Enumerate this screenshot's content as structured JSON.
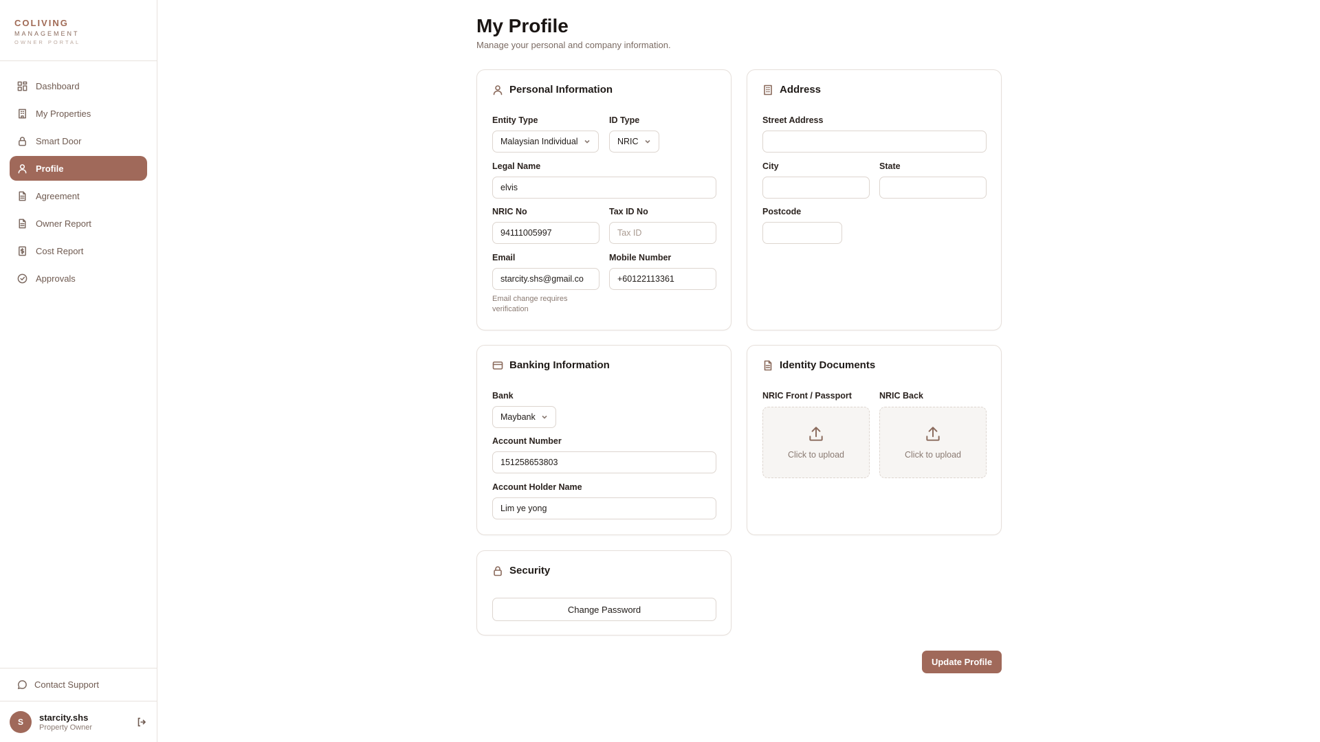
{
  "brand": {
    "title": "COLIVING",
    "subtitle": "MANAGEMENT",
    "portal": "OWNER PORTAL"
  },
  "colors": {
    "accent": "#a0695a",
    "border": "#e6dfda"
  },
  "sidebar": {
    "items": [
      {
        "label": "Dashboard",
        "icon": "grid-icon"
      },
      {
        "label": "My Properties",
        "icon": "building-icon"
      },
      {
        "label": "Smart Door",
        "icon": "lock-icon"
      },
      {
        "label": "Profile",
        "icon": "user-icon",
        "active": true
      },
      {
        "label": "Agreement",
        "icon": "document-icon"
      },
      {
        "label": "Owner Report",
        "icon": "document-icon"
      },
      {
        "label": "Cost Report",
        "icon": "dollar-document-icon"
      },
      {
        "label": "Approvals",
        "icon": "check-circle-icon"
      }
    ],
    "support": "Contact Support",
    "user": {
      "initial": "S",
      "name": "starcity.shs",
      "role": "Property Owner"
    }
  },
  "page": {
    "title": "My Profile",
    "subtitle": "Manage your personal and company information."
  },
  "personal": {
    "title": "Personal Information",
    "entity_type_label": "Entity Type",
    "entity_type_value": "Malaysian Individual",
    "id_type_label": "ID Type",
    "id_type_value": "NRIC",
    "legal_name_label": "Legal Name",
    "legal_name_value": "elvis",
    "nric_label": "NRIC No",
    "nric_value": "94111005997",
    "tax_label": "Tax ID No",
    "tax_placeholder": "Tax ID",
    "email_label": "Email",
    "email_value": "starcity.shs@gmail.co",
    "email_hint": "Email change requires verification",
    "mobile_label": "Mobile Number",
    "mobile_value": "+60122113361"
  },
  "address": {
    "title": "Address",
    "street_label": "Street Address",
    "city_label": "City",
    "state_label": "State",
    "postcode_label": "Postcode"
  },
  "banking": {
    "title": "Banking Information",
    "bank_label": "Bank",
    "bank_value": "Maybank",
    "account_number_label": "Account Number",
    "account_number_value": "151258653803",
    "holder_label": "Account Holder Name",
    "holder_value": "Lim ye yong"
  },
  "identity": {
    "title": "Identity Documents",
    "front_label": "NRIC Front / Passport",
    "back_label": "NRIC Back",
    "upload_text": "Click to upload"
  },
  "security": {
    "title": "Security",
    "change_password": "Change Password"
  },
  "actions": {
    "update": "Update Profile"
  }
}
